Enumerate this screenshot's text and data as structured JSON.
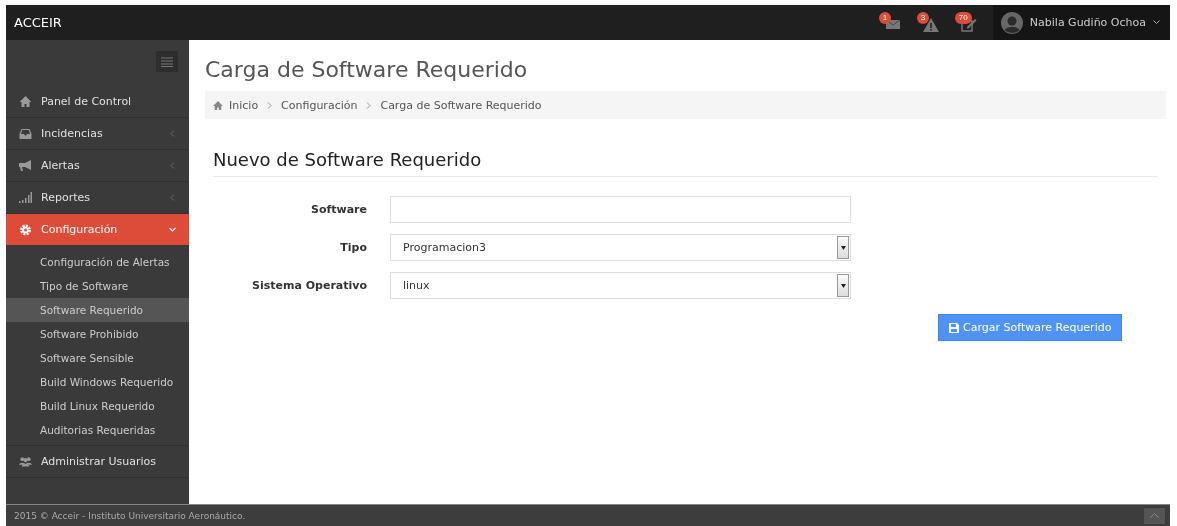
{
  "brand": "ACCEIR",
  "notifications": [
    {
      "kind": "messages",
      "count": "1"
    },
    {
      "kind": "warnings",
      "count": "3"
    },
    {
      "kind": "tasks",
      "count": "70"
    }
  ],
  "user": {
    "name": "Nabila Gudiño Ochoa"
  },
  "sidebar": {
    "items": [
      {
        "label": "Panel de Control",
        "kind": "home",
        "selected": false
      },
      {
        "label": "Incidencias",
        "kind": "inbox",
        "selected": false,
        "expanded": false
      },
      {
        "label": "Alertas",
        "kind": "bullhorn",
        "selected": false,
        "expanded": false
      },
      {
        "label": "Reportes",
        "kind": "signal",
        "selected": false,
        "expanded": false
      },
      {
        "label": "Configuración",
        "kind": "gear",
        "selected": true,
        "expanded": true,
        "children": [
          {
            "label": "Configuración de Alertas",
            "selected": false
          },
          {
            "label": "Tipo de Software",
            "selected": false
          },
          {
            "label": "Software Requerido",
            "selected": true
          },
          {
            "label": "Software Prohibido",
            "selected": false
          },
          {
            "label": "Software Sensible",
            "selected": false
          },
          {
            "label": "Build Windows Requerido",
            "selected": false
          },
          {
            "label": "Build Linux Requerido",
            "selected": false
          },
          {
            "label": "Auditorias Requeridas",
            "selected": false
          }
        ]
      },
      {
        "label": "Administrar Usuarios",
        "kind": "users",
        "selected": false
      }
    ]
  },
  "page_title": "Carga de Software Requerido",
  "breadcrumb": [
    "Inicio",
    "Configuración",
    "Carga de Software Requerido"
  ],
  "form": {
    "title": "Nuevo de Software Requerido",
    "fields": [
      {
        "label": "Software",
        "kind": "text"
      },
      {
        "label": "Tipo",
        "kind": "select",
        "value": "Programacion3"
      },
      {
        "label": "Sistema Operativo",
        "kind": "select",
        "value": "linux"
      }
    ],
    "submit": "Cargar Software Requerido"
  },
  "footer": "2015 © Acceir - Instituto Universitario Aeronáutico."
}
